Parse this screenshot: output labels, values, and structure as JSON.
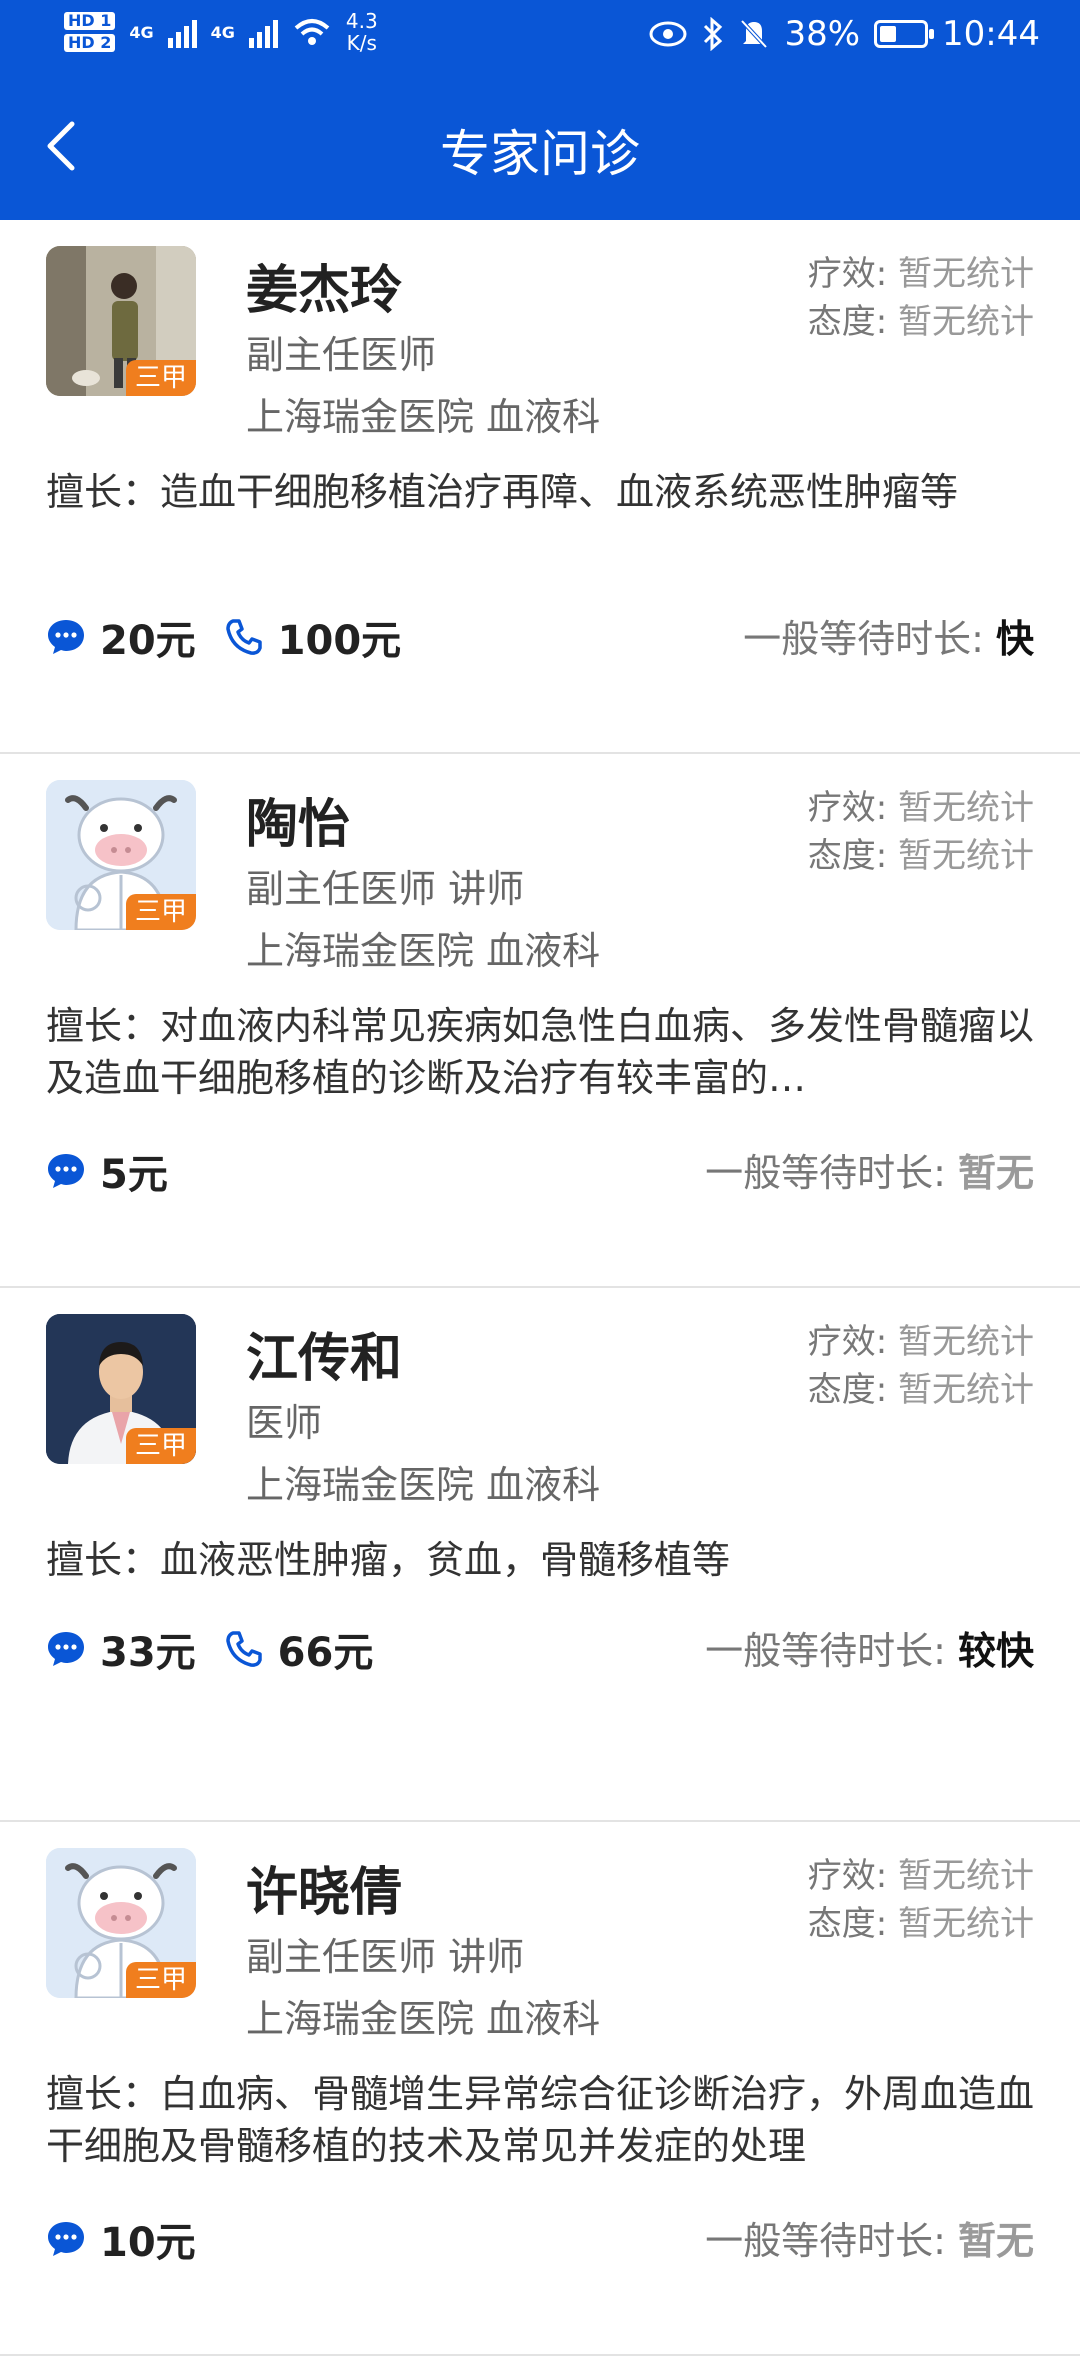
{
  "status_bar": {
    "hd1": "HD 1",
    "hd2": "HD 2",
    "network1": "4G",
    "network2": "4G",
    "speed_value": "4.3",
    "speed_unit": "K/s",
    "battery": "38%",
    "battery_level": 0.38,
    "time": "10:44"
  },
  "header": {
    "title": "专家问诊"
  },
  "doctors": [
    {
      "name": "姜杰玲",
      "title": "副主任医师",
      "hospital": "上海瑞金医院 血液科",
      "badge": "三甲",
      "efficacy_label": "疗效:",
      "efficacy_value": "暂无统计",
      "attitude_label": "态度:",
      "attitude_value": "暂无统计",
      "skill": "擅长：造血干细胞移植治疗再障、血液系统恶性肿瘤等",
      "msg_price": "20元",
      "phone_price": "100元",
      "wait_label": "一般等待时长:",
      "wait_value": "快"
    },
    {
      "name": "陶怡",
      "title": "副主任医师 讲师",
      "hospital": "上海瑞金医院 血液科",
      "badge": "三甲",
      "efficacy_label": "疗效:",
      "efficacy_value": "暂无统计",
      "attitude_label": "态度:",
      "attitude_value": "暂无统计",
      "skill": "擅长：对血液内科常见疾病如急性白血病、多发性骨髓瘤以及造血干细胞移植的诊断及治疗有较丰富的…",
      "msg_price": "5元",
      "wait_label": "一般等待时长:",
      "wait_value": "暂无"
    },
    {
      "name": "江传和",
      "title": "医师",
      "hospital": "上海瑞金医院 血液科",
      "badge": "三甲",
      "efficacy_label": "疗效:",
      "efficacy_value": "暂无统计",
      "attitude_label": "态度:",
      "attitude_value": "暂无统计",
      "skill": "擅长：血液恶性肿瘤，贫血，骨髓移植等",
      "msg_price": "33元",
      "phone_price": "66元",
      "wait_label": "一般等待时长:",
      "wait_value": "较快"
    },
    {
      "name": "许晓倩",
      "title": "副主任医师 讲师",
      "hospital": "上海瑞金医院 血液科",
      "badge": "三甲",
      "efficacy_label": "疗效:",
      "efficacy_value": "暂无统计",
      "attitude_label": "态度:",
      "attitude_value": "暂无统计",
      "skill": "擅长：白血病、骨髓增生异常综合征诊断治疗，外周血造血干细胞及骨髓移植的技术及常见并发症的处理",
      "msg_price": "10元",
      "wait_label": "一般等待时长:",
      "wait_value": "暂无"
    }
  ],
  "colors": {
    "brand_blue": "#0a56d6",
    "badge_orange": "#f07e1e",
    "wait_fast": "#111111",
    "wait_none": "#9a9a9a"
  }
}
